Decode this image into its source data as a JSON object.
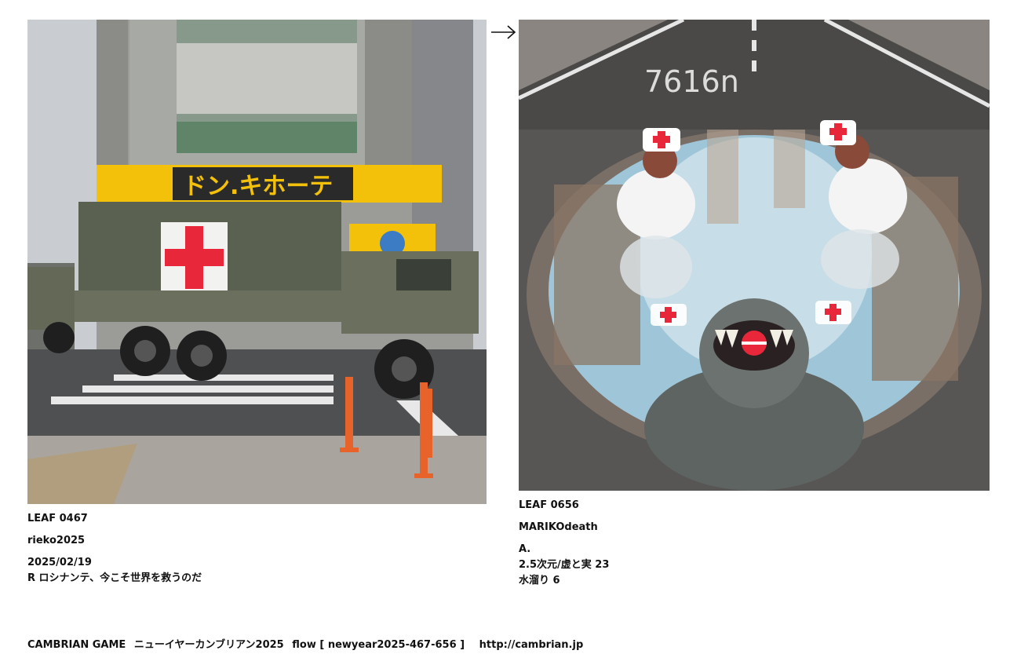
{
  "left_card": {
    "leaf_id": "LEAF 0467",
    "author": "rieko2025",
    "date": "2025/02/19",
    "title": "R ロシナンテ、今こそ世界を救うのだ",
    "sign_text": "ドン.キホーテ"
  },
  "right_card": {
    "leaf_id": "LEAF 0656",
    "author": "MARIKOdeath",
    "lines": [
      "A.",
      "2.5次元/虚と実 23",
      "水溜り 6"
    ],
    "road_text": "7616n"
  },
  "arrow": "→",
  "footer": {
    "game": "CAMBRIAN GAME",
    "event": "ニューイヤーカンブリアン2025",
    "flow": "flow [ newyear2025-467-656 ]",
    "url": "http://cambrian.jp"
  },
  "colors": {
    "red_cross": "#e8283a",
    "truck_olive": "#5b6150",
    "sign_yellow": "#f3c10a",
    "puddle_blue": "#9fc6d8"
  }
}
